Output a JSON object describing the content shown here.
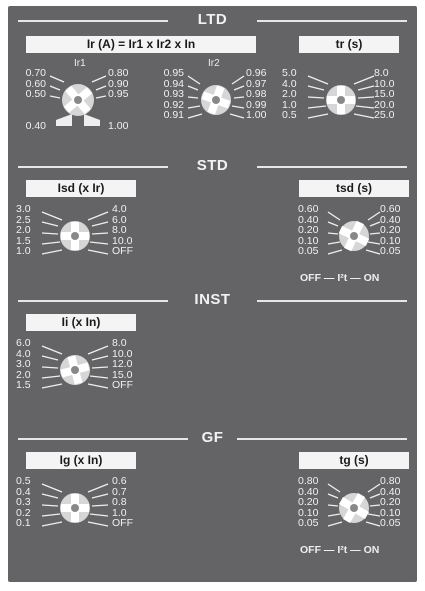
{
  "sections": {
    "ltd": "LTD",
    "std": "STD",
    "inst": "INST",
    "gf": "GF"
  },
  "ltd": {
    "ir_label": "Ir (A) = Ir1 x Ir2 x In",
    "ir1_caption": "Ir1",
    "ir2_caption": "Ir2",
    "ir1_left": [
      "0.70",
      "0.60",
      "0.50",
      "",
      "0.40"
    ],
    "ir1_right": [
      "0.80",
      "0.90",
      "0.95",
      "",
      "1.00"
    ],
    "ir2_left": [
      "0.95",
      "0.94",
      "0.93",
      "0.92",
      "0.91"
    ],
    "ir2_right": [
      "0.96",
      "0.97",
      "0.98",
      "0.99",
      "1.00"
    ],
    "tr_label": "tr (s)",
    "tr_left": [
      "5.0",
      "4.0",
      "2.0",
      "1.0",
      "0.5"
    ],
    "tr_right": [
      "8.0",
      "10.0",
      "15.0",
      "20.0",
      "25.0"
    ]
  },
  "std": {
    "isd_label": "Isd (x Ir)",
    "isd_left": [
      "3.0",
      "2.5",
      "2.0",
      "1.5",
      "1.0"
    ],
    "isd_right": [
      "4.0",
      "6.0",
      "8.0",
      "10.0",
      "OFF"
    ],
    "tsd_label": "tsd (s)",
    "tsd_left": [
      "0.60",
      "0.40",
      "0.20",
      "0.10",
      "0.05"
    ],
    "tsd_right": [
      "0.60",
      "0.40",
      "0.20",
      "0.10",
      "0.05"
    ],
    "tsd_footer": "OFF — I²t — ON"
  },
  "inst": {
    "ii_label": "Ii (x In)",
    "ii_left": [
      "6.0",
      "4.0",
      "3.0",
      "2.0",
      "1.5"
    ],
    "ii_right": [
      "8.0",
      "10.0",
      "12.0",
      "15.0",
      "OFF"
    ]
  },
  "gf": {
    "ig_label": "Ig (x In)",
    "ig_left": [
      "0.5",
      "0.4",
      "0.3",
      "0.2",
      "0.1"
    ],
    "ig_right": [
      "0.6",
      "0.7",
      "0.8",
      "1.0",
      "OFF"
    ],
    "tg_label": "tg (s)",
    "tg_left": [
      "0.80",
      "0.40",
      "0.20",
      "0.10",
      "0.05"
    ],
    "tg_right": [
      "0.80",
      "0.40",
      "0.20",
      "0.10",
      "0.05"
    ],
    "tg_footer": "OFF — I²t — ON"
  },
  "colors": {
    "panel": "#646466",
    "label_bg": "#f4f4f4",
    "text": "#f0f0f0"
  }
}
